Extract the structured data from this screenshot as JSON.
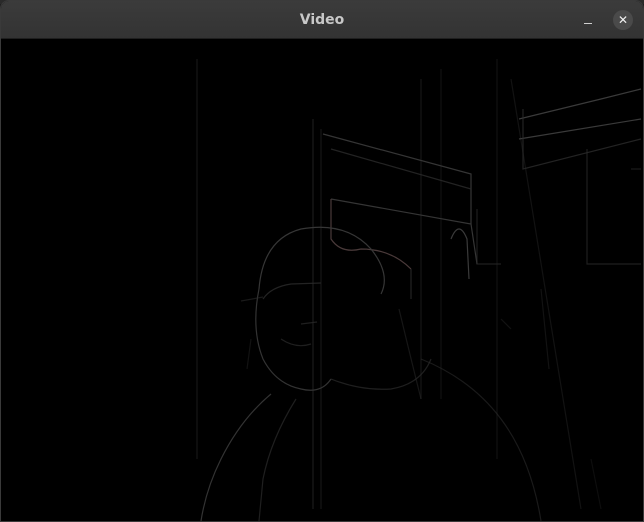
{
  "window": {
    "title": "Video"
  },
  "icons": {
    "minimize": "minimize-icon",
    "close": "close-icon"
  },
  "colors": {
    "titlebar": "#383838",
    "title_text": "#c8c8c8",
    "video_background": "#000000",
    "edge_lines": "#2c2c2c"
  }
}
